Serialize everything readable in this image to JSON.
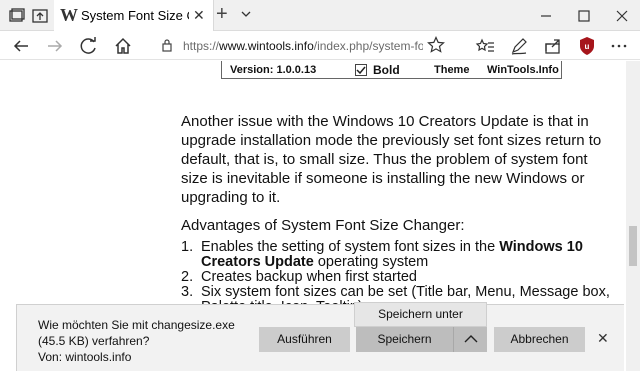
{
  "tab": {
    "title": "System Font Size Chang",
    "favicon": "W",
    "close": "✕"
  },
  "window": {
    "newtab": "+",
    "minimize_icon": "minimize-icon",
    "maximize_icon": "maximize-icon",
    "close_icon": "close-icon"
  },
  "address": {
    "prefix": "https://",
    "host": "www.wintools.info",
    "path": "/index.php/system-fo"
  },
  "page": {
    "strip": {
      "version": "Version: 1.0.0.13",
      "bold": "Bold",
      "theme": "Theme",
      "site": "WinTools.Info"
    },
    "para1": "Another issue with the Windows 10 Creators Update is that in upgrade installation mode the previously set font sizes return to default, that is, to small size. Thus the problem of system font size is inevitable if someone is installing the new Windows or upgrading to it.",
    "para2": "Advantages of System Font Size Changer:",
    "list": [
      {
        "num": "1.",
        "pre": "Enables the setting of system font sizes in the ",
        "bold": "Windows 10 Creators Update",
        "post": " operating system"
      },
      {
        "num": "2.",
        "pre": "Creates backup when first started",
        "bold": "",
        "post": ""
      },
      {
        "num": "3.",
        "pre": "Six system font sizes can be set (Title bar, Menu, Message box, Palette title, Icon, Tooltip)",
        "bold": "",
        "post": ""
      }
    ]
  },
  "download": {
    "line1": "Wie möchten Sie mit changesize.exe",
    "line2": "(45.5 KB) verfahren?",
    "line3": "Von: wintools.info",
    "run": "Ausführen",
    "save": "Speichern",
    "cancel": "Abbrechen",
    "save_as": "Speichern unter",
    "close": "✕"
  }
}
